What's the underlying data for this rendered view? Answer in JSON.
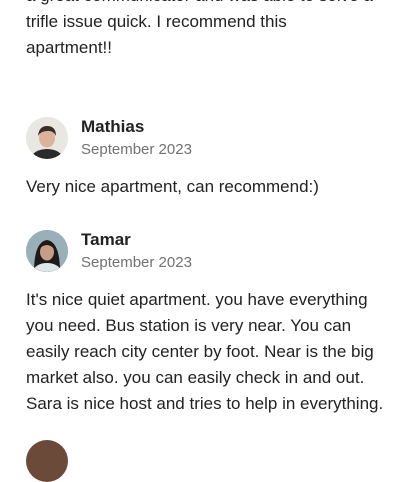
{
  "top_review": {
    "text": "a great communicator and was able to solve a\ntrifle issue quick. I recommend this\napartment!!"
  },
  "reviews": [
    {
      "name": "Mathias",
      "date": "September 2023",
      "text": "Very nice apartment, can recommend:)",
      "avatar_colors": {
        "bg": "#e9e7e2",
        "hair": "#3a2d25",
        "face": "#d9b49b",
        "shirt": "#2b2b2b"
      }
    },
    {
      "name": "Tamar",
      "date": "September 2023",
      "text": "It's nice quiet apartment. you have everything\nyou need. Bus station is very near. You can\neasily reach city center by foot. Near is the big\nmarket also. you can easily check in and out.\nSara is nice host and tries to help in everything.",
      "avatar_colors": {
        "bg": "#9ab0b8",
        "hair": "#1e1a1a",
        "face": "#c89d86",
        "shirt": "#dfe6ea"
      }
    }
  ],
  "partial_review": {
    "name": ""
  }
}
